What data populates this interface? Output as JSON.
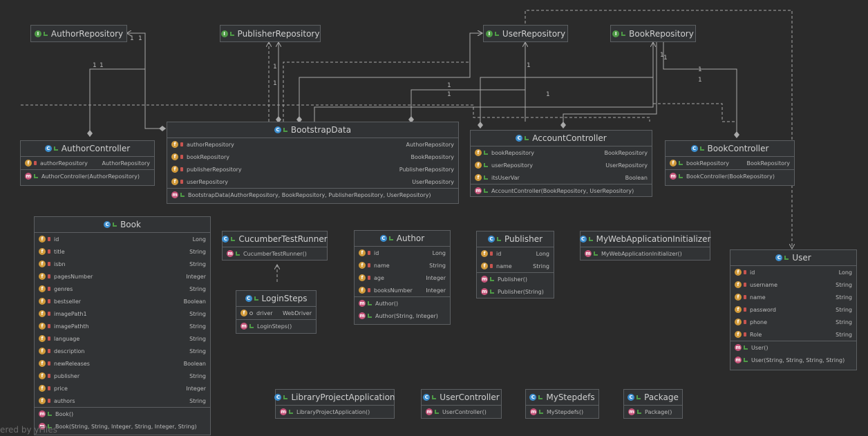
{
  "interfaces": {
    "author_repo": "AuthorRepository",
    "publisher_repo": "PublisherRepository",
    "user_repo": "UserRepository",
    "book_repo": "BookRepository"
  },
  "classes": {
    "author_controller": {
      "name": "AuthorController",
      "fields": [
        {
          "name": "authorRepository",
          "type": "AuthorRepository"
        }
      ],
      "methods": [
        "AuthorController(AuthorRepository)"
      ]
    },
    "bootstrap_data": {
      "name": "BootstrapData",
      "fields": [
        {
          "name": "authorRepository",
          "type": "AuthorRepository"
        },
        {
          "name": "bookRepository",
          "type": "BookRepository"
        },
        {
          "name": "publisherRepository",
          "type": "PublisherRepository"
        },
        {
          "name": "userRepository",
          "type": "UserRepository"
        }
      ],
      "methods": [
        "BootstrapData(AuthorRepository, BookRepository, PublisherRepository, UserRepository)"
      ]
    },
    "account_controller": {
      "name": "AccountController",
      "fields": [
        {
          "name": "bookRepository",
          "type": "BookRepository"
        },
        {
          "name": "userRepository",
          "type": "UserRepository"
        },
        {
          "name": "itsUserVar",
          "type": "Boolean"
        }
      ],
      "methods": [
        "AccountController(BookRepository, UserRepository)"
      ]
    },
    "book_controller": {
      "name": "BookController",
      "fields": [
        {
          "name": "bookRepository",
          "type": "BookRepository"
        }
      ],
      "methods": [
        "BookController(BookRepository)"
      ]
    },
    "book": {
      "name": "Book",
      "fields": [
        {
          "name": "id",
          "type": "Long"
        },
        {
          "name": "title",
          "type": "String"
        },
        {
          "name": "isbn",
          "type": "String"
        },
        {
          "name": "pagesNumber",
          "type": "Integer"
        },
        {
          "name": "genres",
          "type": "String"
        },
        {
          "name": "bestseller",
          "type": "Boolean"
        },
        {
          "name": "imagePath1",
          "type": "String"
        },
        {
          "name": "imagePathth",
          "type": "String"
        },
        {
          "name": "language",
          "type": "String"
        },
        {
          "name": "description",
          "type": "String"
        },
        {
          "name": "newReleases",
          "type": "Boolean"
        },
        {
          "name": "publisher",
          "type": "String"
        },
        {
          "name": "price",
          "type": "Integer"
        },
        {
          "name": "authors",
          "type": "String"
        }
      ],
      "methods": [
        "Book()",
        "Book(String, String, Integer, String, Integer, String)"
      ]
    },
    "cucumber_test_runner": {
      "name": "CucumberTestRunner",
      "methods": [
        "CucumberTestRunner()"
      ]
    },
    "login_steps": {
      "name": "LoginSteps",
      "fields": [
        {
          "name": "driver",
          "type": "WebDriver"
        }
      ],
      "methods": [
        "LoginSteps()"
      ]
    },
    "author": {
      "name": "Author",
      "fields": [
        {
          "name": "id",
          "type": "Long"
        },
        {
          "name": "name",
          "type": "String"
        },
        {
          "name": "age",
          "type": "Integer"
        },
        {
          "name": "booksNumber",
          "type": "Integer"
        }
      ],
      "methods": [
        "Author()",
        "Author(String, Integer)"
      ]
    },
    "publisher": {
      "name": "Publisher",
      "fields": [
        {
          "name": "id",
          "type": "Long"
        },
        {
          "name": "name",
          "type": "String"
        }
      ],
      "methods": [
        "Publisher()",
        "Publisher(String)"
      ]
    },
    "my_web_app_initializer": {
      "name": "MyWebApplicationInitializer",
      "methods": [
        "MyWebApplicationInitializer()"
      ]
    },
    "user": {
      "name": "User",
      "fields": [
        {
          "name": "id",
          "type": "Long"
        },
        {
          "name": "username",
          "type": "String"
        },
        {
          "name": "name",
          "type": "String"
        },
        {
          "name": "password",
          "type": "String"
        },
        {
          "name": "phone",
          "type": "String"
        },
        {
          "name": "Role",
          "type": "String"
        }
      ],
      "methods": [
        "User()",
        "User(String, String, String, String)"
      ]
    },
    "library_project_application": {
      "name": "LibraryProjectApplication",
      "methods": [
        "LibraryProjectApplication()"
      ]
    },
    "user_controller": {
      "name": "UserController",
      "methods": [
        "UserController()"
      ]
    },
    "my_stepdefs": {
      "name": "MyStepdefs",
      "methods": [
        "MyStepdefs()"
      ]
    },
    "package": {
      "name": "Package",
      "methods": [
        "Package()"
      ]
    }
  },
  "multiplicity": "1",
  "watermark": "ered by yFiles",
  "colors": {
    "background": "#2b2b2b",
    "node_fill": "#313335",
    "node_border": "#5c5f62",
    "edge": "#a9a9a9",
    "interface_badge": "#4e9a46",
    "class_badge": "#3d8fd0",
    "field_badge": "#d19a3a",
    "method_badge": "#c7547a"
  }
}
